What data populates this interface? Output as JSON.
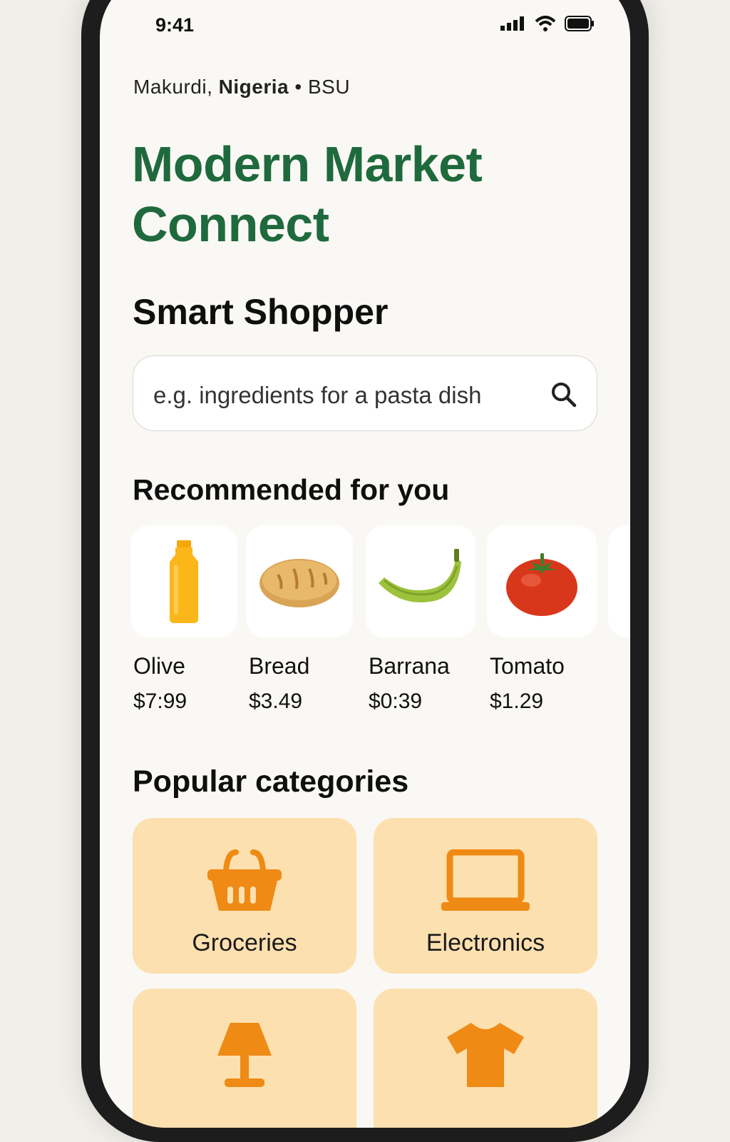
{
  "status_bar": {
    "time": "9:41"
  },
  "location": {
    "city": "Makurdi,",
    "country": "Nigeria",
    "separator": "•",
    "campus": "BSU"
  },
  "app": {
    "title": "Modern Market Connect"
  },
  "smart_shopper": {
    "heading": "Smart Shopper",
    "search_placeholder": "e.g. ingredients for a pasta dish"
  },
  "recommended": {
    "heading": "Recommended for you",
    "items": [
      {
        "name": "Olive",
        "price": "$7:99",
        "icon": "bottle-icon"
      },
      {
        "name": "Bread",
        "price": "$3.49",
        "icon": "bread-icon"
      },
      {
        "name": "Barrana",
        "price": "$0:39",
        "icon": "banana-icon"
      },
      {
        "name": "Tomato",
        "price": "$1.29",
        "icon": "tomato-icon"
      }
    ]
  },
  "categories": {
    "heading": "Popular categories",
    "items": [
      {
        "label": "Groceries",
        "icon": "basket-icon"
      },
      {
        "label": "Electronics",
        "icon": "laptop-icon"
      },
      {
        "label": "",
        "icon": "lamp-icon"
      },
      {
        "label": "",
        "icon": "tshirt-icon"
      }
    ]
  },
  "colors": {
    "brand_green": "#1f6a3d",
    "category_bg": "#fde0af",
    "category_icon": "#ef8a14"
  }
}
